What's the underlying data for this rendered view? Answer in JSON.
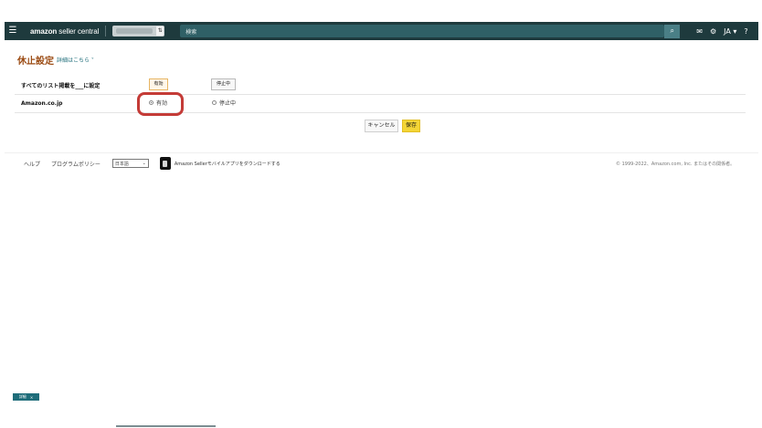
{
  "header": {
    "brand_bold": "amazon",
    "brand_light": " seller central",
    "search_placeholder": "検索",
    "language": "JA",
    "icons": [
      "menu-icon",
      "mail-icon",
      "gear-icon",
      "help-icon"
    ]
  },
  "page": {
    "title": "休止設定",
    "detail_link": "詳細はこちら",
    "all_listings_label": "すべてのリスト掲載を___に設定",
    "active_button": "有効",
    "stop_button": "停止中",
    "marketplace": "Amazon.co.jp",
    "radio_active": "有効",
    "radio_stop": "停止中",
    "cancel": "キャンセル",
    "save": "保存"
  },
  "footer": {
    "help": "ヘルプ",
    "policy": "プログラムポリシー",
    "language_select": "日本語",
    "app_text": "Amazon Sellerモバイルアプリをダウンロードする",
    "copyright": "© 1999-2022、Amazon.com, Inc. またはその関係者。"
  },
  "badge": {
    "label": "詳細",
    "close": "×"
  },
  "colors": {
    "header_bg": "#1e3a3d",
    "title": "#9b4b13",
    "save": "#f3d536",
    "highlight": "#c43b37"
  }
}
